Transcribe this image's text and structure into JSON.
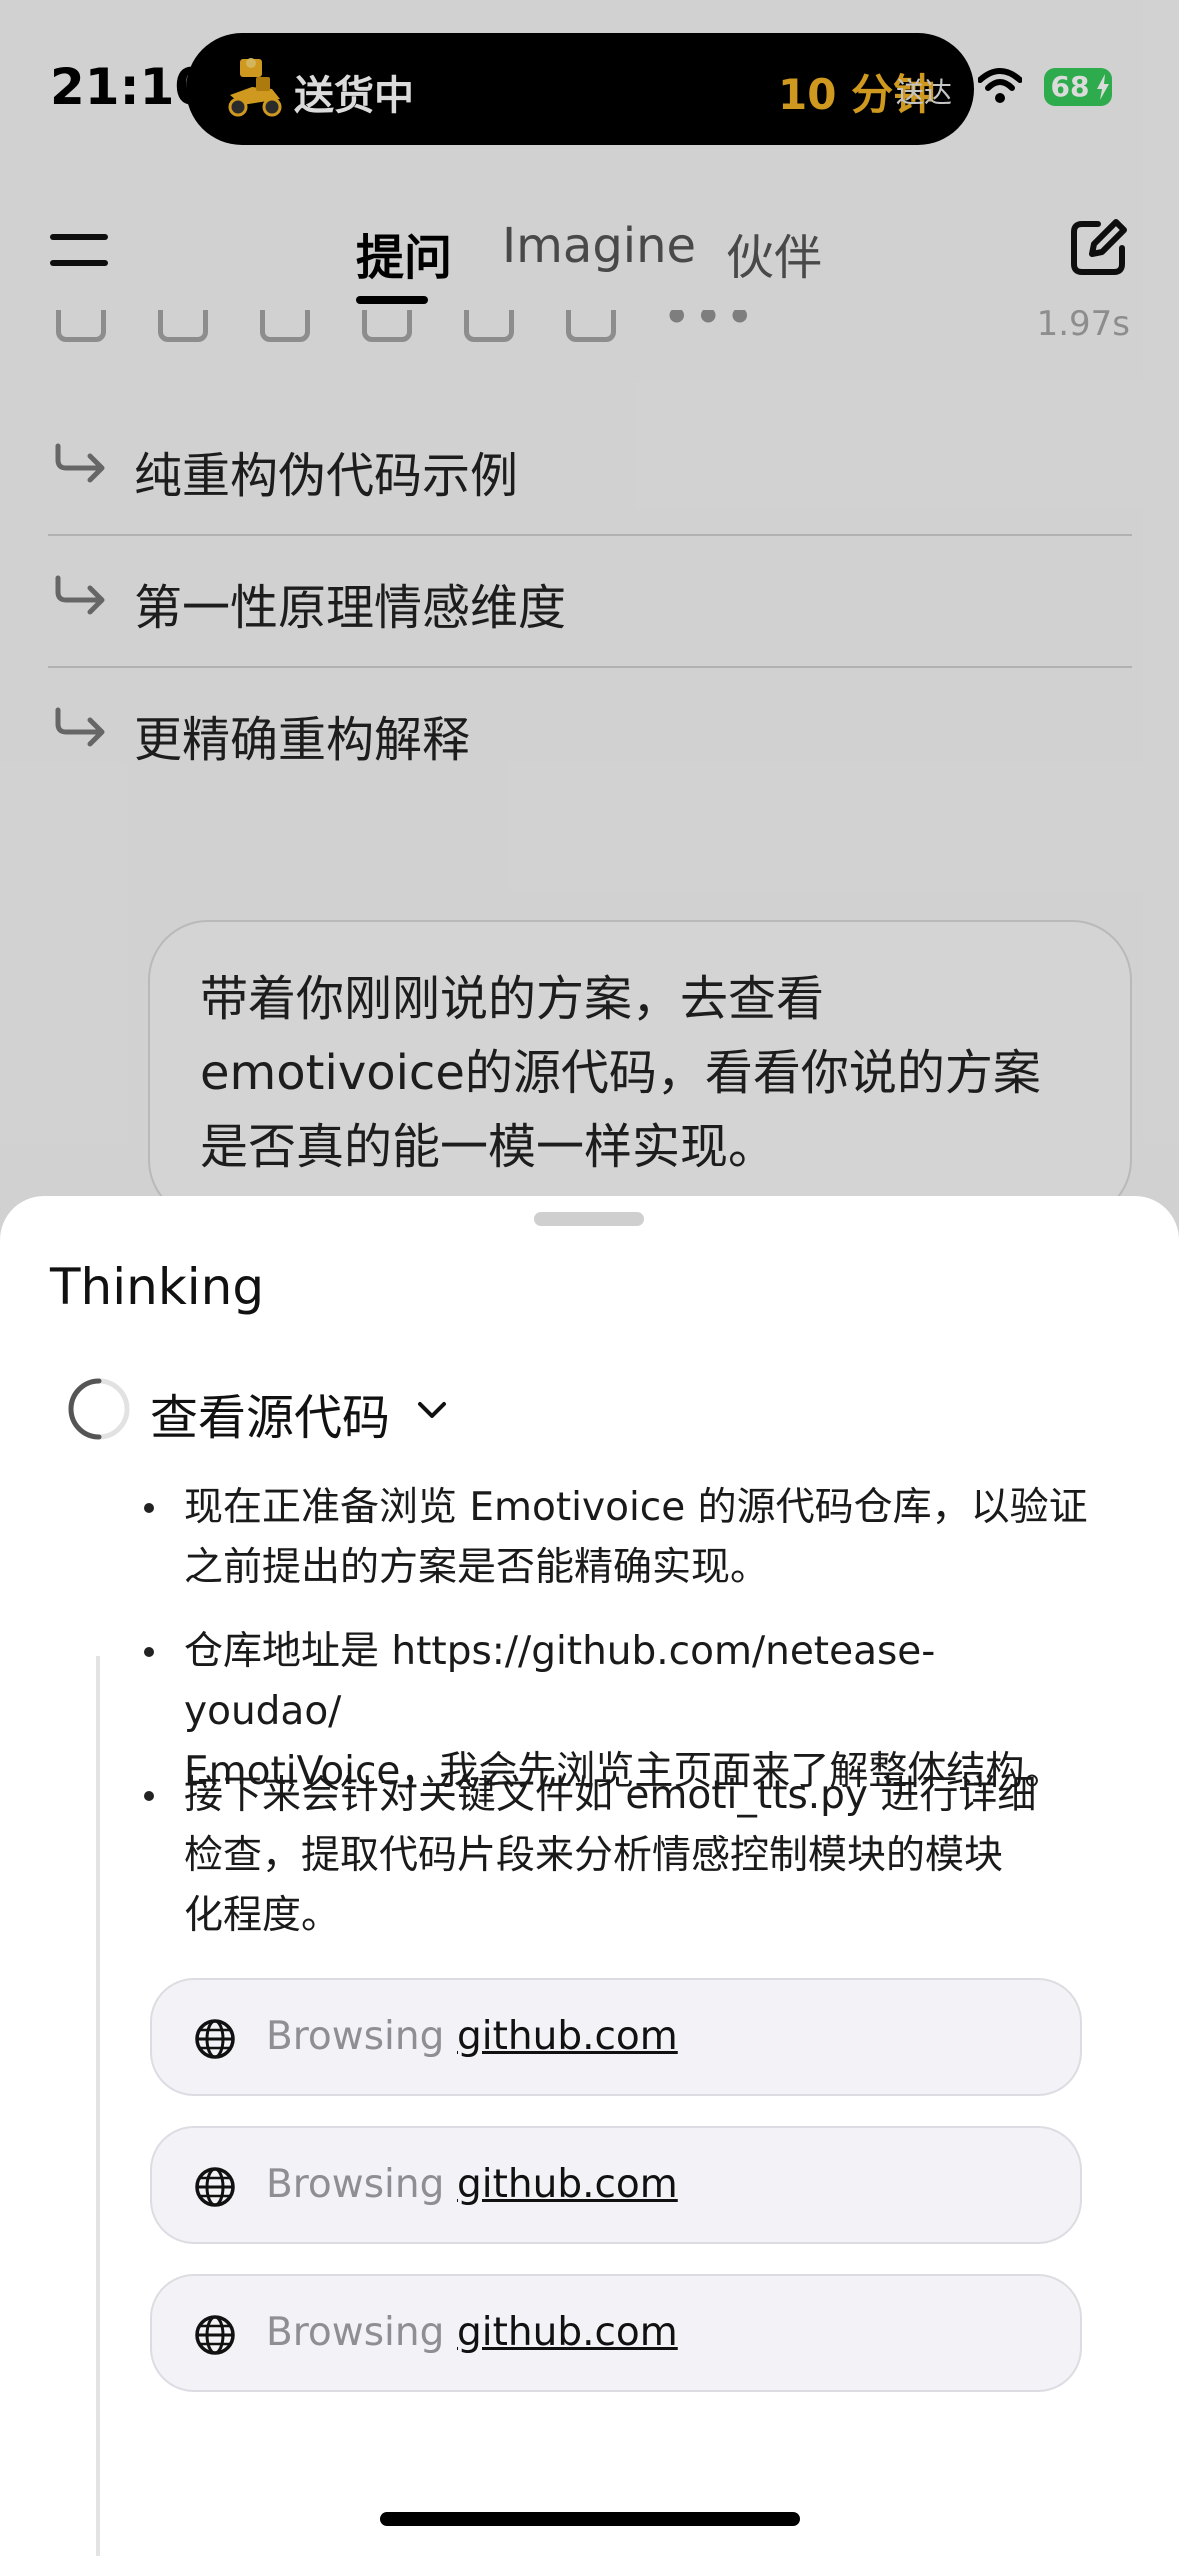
{
  "status_bar": {
    "time": "21:10",
    "live_activity": {
      "label": "送货中",
      "eta": "10 分钟",
      "eta_suffix": "送达"
    },
    "battery": "68"
  },
  "header": {
    "tabs": [
      {
        "label": "提问",
        "active": true
      },
      {
        "label": "Imagine",
        "active": false
      },
      {
        "label": "伙伴",
        "active": false
      }
    ]
  },
  "response_actions": {
    "elapsed": "1.97s"
  },
  "suggestions": [
    {
      "label": "纯重构伪代码示例"
    },
    {
      "label": "第一性原理情感维度"
    },
    {
      "label": "更精确重构解释"
    }
  ],
  "user_message": {
    "line1": "带着你刚刚说的方案，去查看",
    "line2": "emotivoice的源代码，看看你说的方案",
    "line3": "是否真的能一模一样实现。"
  },
  "thinking_sheet": {
    "title": "Thinking",
    "step_title": "查看源代码",
    "bullets": [
      {
        "line1": "现在正准备浏览 Emotivoice 的源代码仓库，以验证",
        "line2": "之前提出的方案是否能精确实现。"
      },
      {
        "line1": "仓库地址是 https://github.com/netease-youdao/",
        "line2": "EmotiVoice，我会先浏览主页面来了解整体结构。"
      },
      {
        "line1": "接下来会针对关键文件如 emoti_tts.py 进行详细",
        "line2": "检查，提取代码片段来分析情感控制模块的模块",
        "line3": "化程度。"
      }
    ],
    "browsing": [
      {
        "label": "Browsing",
        "site": "github.com"
      },
      {
        "label": "Browsing",
        "site": "github.com"
      },
      {
        "label": "Browsing",
        "site": "github.com"
      }
    ]
  },
  "colors": {
    "eta_accent": "#f0b323",
    "battery": "#36c759",
    "sheet_bg": "#ffffff"
  }
}
